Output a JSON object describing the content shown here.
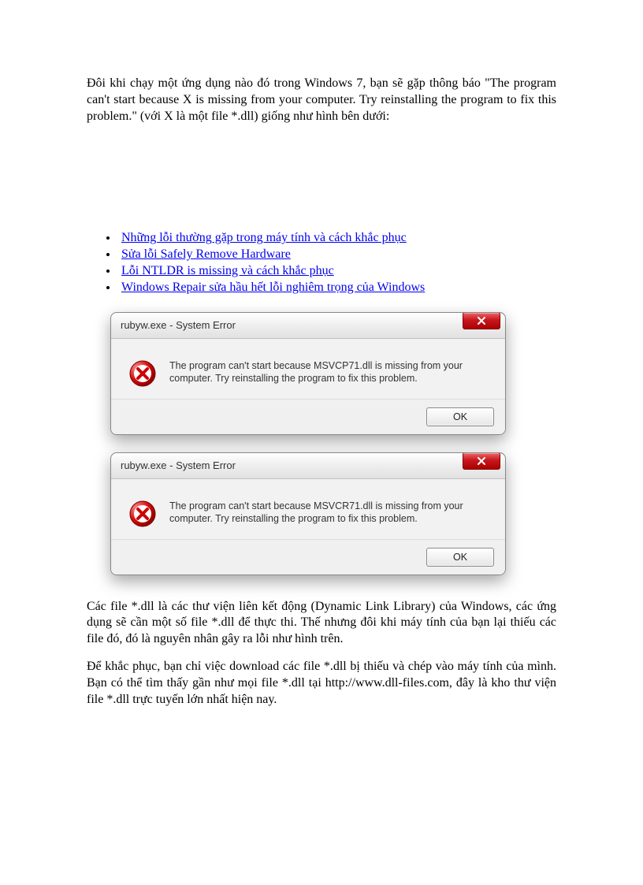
{
  "intro": "Đôi khi chạy một ứng dụng nào đó trong Windows 7, bạn sẽ gặp thông báo \"The program can't start because X is missing from your computer. Try reinstalling the program to fix this problem.\" (với X là một file *.dll) giống như hình bên dưới:",
  "links": [
    "Những lỗi thường gặp trong máy tính và cách khắc phục",
    "Sửa lỗi Safely Remove Hardware",
    "Lỗi NTLDR is missing và cách khắc phục",
    "Windows Repair sửa hầu hết lỗi nghiêm trọng của Windows"
  ],
  "dialogs": [
    {
      "title": "rubyw.exe - System Error",
      "message": "The program can't start because MSVCP71.dll is missing from your computer. Try reinstalling the program to fix this problem.",
      "ok": "OK"
    },
    {
      "title": "rubyw.exe - System Error",
      "message": "The program can't start because MSVCR71.dll is missing from your computer. Try reinstalling the program to fix this problem.",
      "ok": "OK"
    }
  ],
  "para2": "Các file *.dll là các thư viện liên kết động (Dynamic Link Library) của Windows, các ứng dụng sẽ cần một số file *.dll để thực thi. Thế nhưng đôi khi máy tính của bạn lại thiếu các file đó, đó là nguyên nhân gây ra lỗi như hình trên.",
  "para3": "Để khắc phục, bạn chỉ việc download các file *.dll bị thiếu và chép vào máy tính của mình. Bạn có thể tìm thấy gần như mọi file *.dll tại http://www.dll-files.com, đây là kho thư viện file *.dll trực tuyến lớn nhất hiện nay."
}
